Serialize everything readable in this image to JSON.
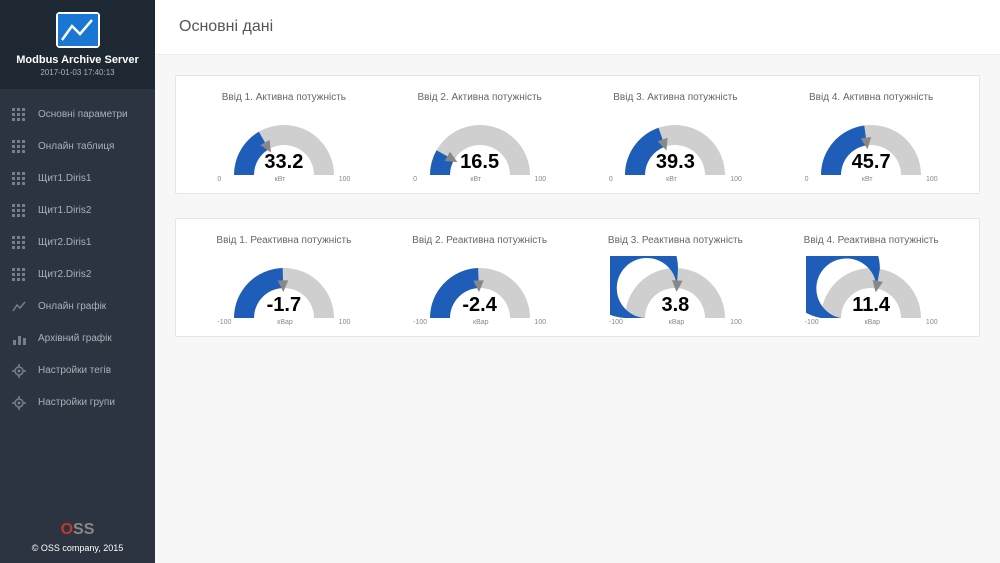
{
  "app": {
    "title": "Modbus Archive Server",
    "timestamp": "2017-01-03 17:40:13"
  },
  "sidebar": {
    "items": [
      {
        "label": "Основні параметри",
        "icon": "grid"
      },
      {
        "label": "Онлайн таблиця",
        "icon": "grid"
      },
      {
        "label": "Щит1.Diris1",
        "icon": "grid"
      },
      {
        "label": "Щит1.Diris2",
        "icon": "grid"
      },
      {
        "label": "Щит2.Diris1",
        "icon": "grid"
      },
      {
        "label": "Щит2.Diris2",
        "icon": "grid"
      },
      {
        "label": "Онлайн графік",
        "icon": "line"
      },
      {
        "label": "Архівний графік",
        "icon": "bar"
      },
      {
        "label": "Настройки тегів",
        "icon": "gear"
      },
      {
        "label": "Настройки групи",
        "icon": "gear"
      }
    ]
  },
  "footer": {
    "copyright": "© OSS company, 2015"
  },
  "page": {
    "title": "Основні дані"
  },
  "chart_data": [
    {
      "type": "gauge",
      "row": 0,
      "gauges": [
        {
          "title": "Ввід 1. Активна потужність",
          "value": 33.2,
          "min": 0,
          "max": 100,
          "unit": "кВт"
        },
        {
          "title": "Ввід 2. Активна потужність",
          "value": 16.5,
          "min": 0,
          "max": 100,
          "unit": "кВт"
        },
        {
          "title": "Ввід 3. Активна потужність",
          "value": 39.3,
          "min": 0,
          "max": 100,
          "unit": "кВт"
        },
        {
          "title": "Ввід 4. Активна потужність",
          "value": 45.7,
          "min": 0,
          "max": 100,
          "unit": "кВт"
        }
      ]
    },
    {
      "type": "gauge",
      "row": 1,
      "gauges": [
        {
          "title": "Ввід 1. Реактивна потужність",
          "value": -1.7,
          "min": -100,
          "max": 100,
          "unit": "кВар"
        },
        {
          "title": "Ввід 2. Реактивна потужність",
          "value": -2.4,
          "min": -100,
          "max": 100,
          "unit": "кВар"
        },
        {
          "title": "Ввід 3. Реактивна потужність",
          "value": 3.8,
          "min": -100,
          "max": 100,
          "unit": "кВар"
        },
        {
          "title": "Ввід 4. Реактивна потужність",
          "value": 11.4,
          "min": -100,
          "max": 100,
          "unit": "кВар"
        }
      ]
    }
  ]
}
